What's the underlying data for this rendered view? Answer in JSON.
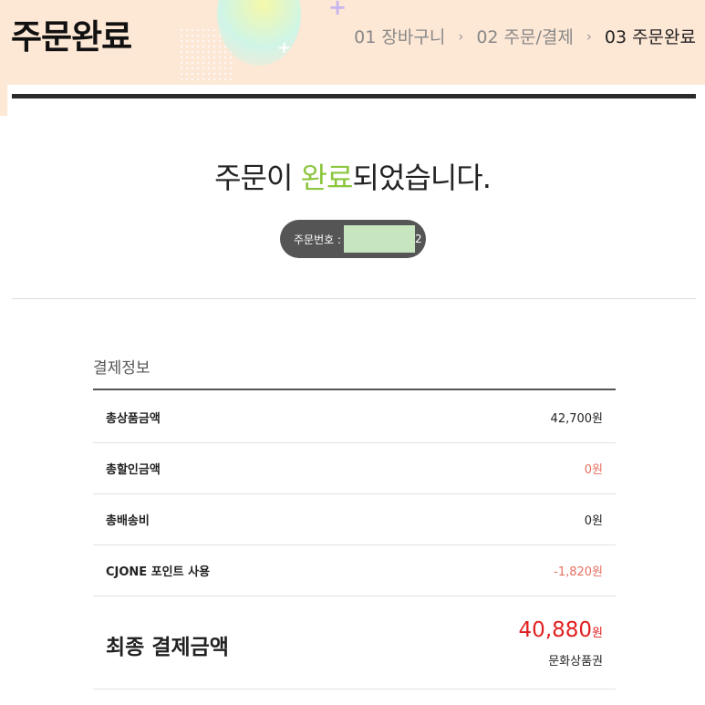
{
  "header": {
    "title": "주문완료",
    "steps": [
      {
        "label": "01 장바구니"
      },
      {
        "label": "02 주문/결제"
      },
      {
        "label": "03 주문완료"
      }
    ]
  },
  "completion": {
    "msg_prefix": "주문이 ",
    "msg_accent": "완료",
    "msg_suffix": "되었습니다.",
    "order_label": "주문번호 :",
    "order_suffix": "2"
  },
  "payment": {
    "section_title": "결제정보",
    "rows": [
      {
        "label": "총상품금액",
        "value": "42,700원"
      },
      {
        "label": "총할인금액",
        "value": "0원"
      },
      {
        "label": "총배송비",
        "value": "0원"
      },
      {
        "label": "CJONE 포인트 사용",
        "value": "-1,820원"
      }
    ],
    "total": {
      "label": "최종 결제금액",
      "amount": "40,880",
      "unit": "원",
      "method": "문화상품권"
    }
  },
  "colors": {
    "accent_green": "#8cc63f",
    "discount_red": "#e57060",
    "total_red": "#e11f1f",
    "header_bg": "#fde7d5"
  }
}
